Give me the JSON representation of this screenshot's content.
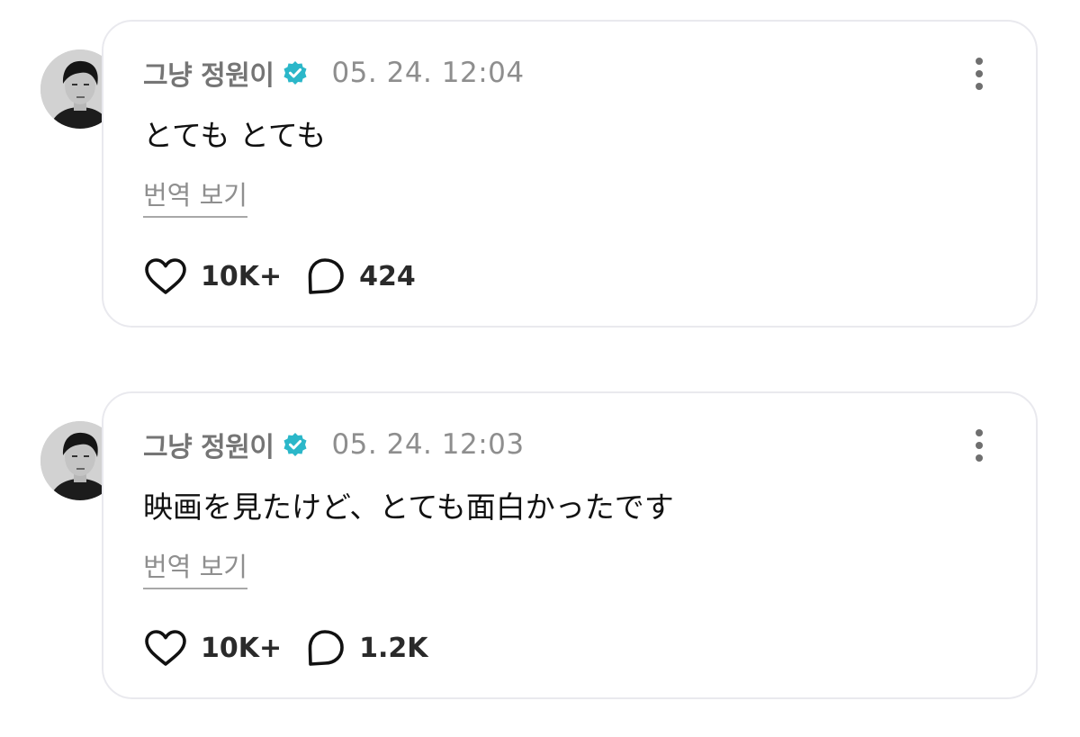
{
  "posts": [
    {
      "author": "그냥 정원이",
      "timestamp": "05. 24. 12:04",
      "content": "とても とても",
      "translate_label": "번역 보기",
      "likes": "10K+",
      "comments": "424",
      "verified": true
    },
    {
      "author": "그냥 정원이",
      "timestamp": "05. 24. 12:03",
      "content": "映画を見たけど、とても面白かったです",
      "translate_label": "번역 보기",
      "likes": "10K+",
      "comments": "1.2K",
      "verified": true
    }
  ],
  "icons": {
    "verified": "verified-badge-icon",
    "more": "more-vertical-icon",
    "like": "heart-icon",
    "comment": "comment-bubble-icon"
  },
  "colors": {
    "verified_badge": "#2bb7c9",
    "card_border": "#e9e9ee",
    "author_text": "#757575",
    "timestamp_text": "#8e8e8e"
  }
}
